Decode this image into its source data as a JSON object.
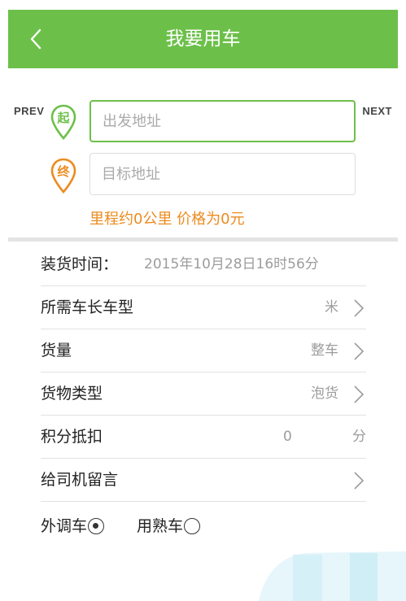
{
  "header": {
    "title": "我要用车"
  },
  "nav": {
    "prev_label": "PREV",
    "next_label": "NEXT"
  },
  "route": {
    "start_pin_char": "起",
    "end_pin_char": "终",
    "start_placeholder": "出发地址",
    "end_placeholder": "目标地址",
    "start_value": "",
    "end_value": "",
    "summary": "里程约0公里 价格为0元"
  },
  "form": {
    "load_time_label": "装货时间：",
    "load_time_value": "2015年10月28日16时56分",
    "car_label": "所需车长车型",
    "car_value": "米",
    "amount_label": "货量",
    "amount_value": "整车",
    "goods_type_label": "货物类型",
    "goods_type_value": "泡货",
    "points_label": "积分抵扣",
    "points_value": "0",
    "points_unit": "分",
    "message_label": "给司机留言"
  },
  "radios": {
    "outsource_label": "外调车",
    "familiar_label": "用熟车",
    "selected": "外调车"
  },
  "colors": {
    "brand_green": "#6cc04a",
    "accent_orange": "#ec8b1e"
  },
  "icons": {
    "back": "chevron-left-icon",
    "start_pin": "start-pin-icon",
    "end_pin": "end-pin-icon",
    "row_arrow": "chevron-right-icon"
  }
}
